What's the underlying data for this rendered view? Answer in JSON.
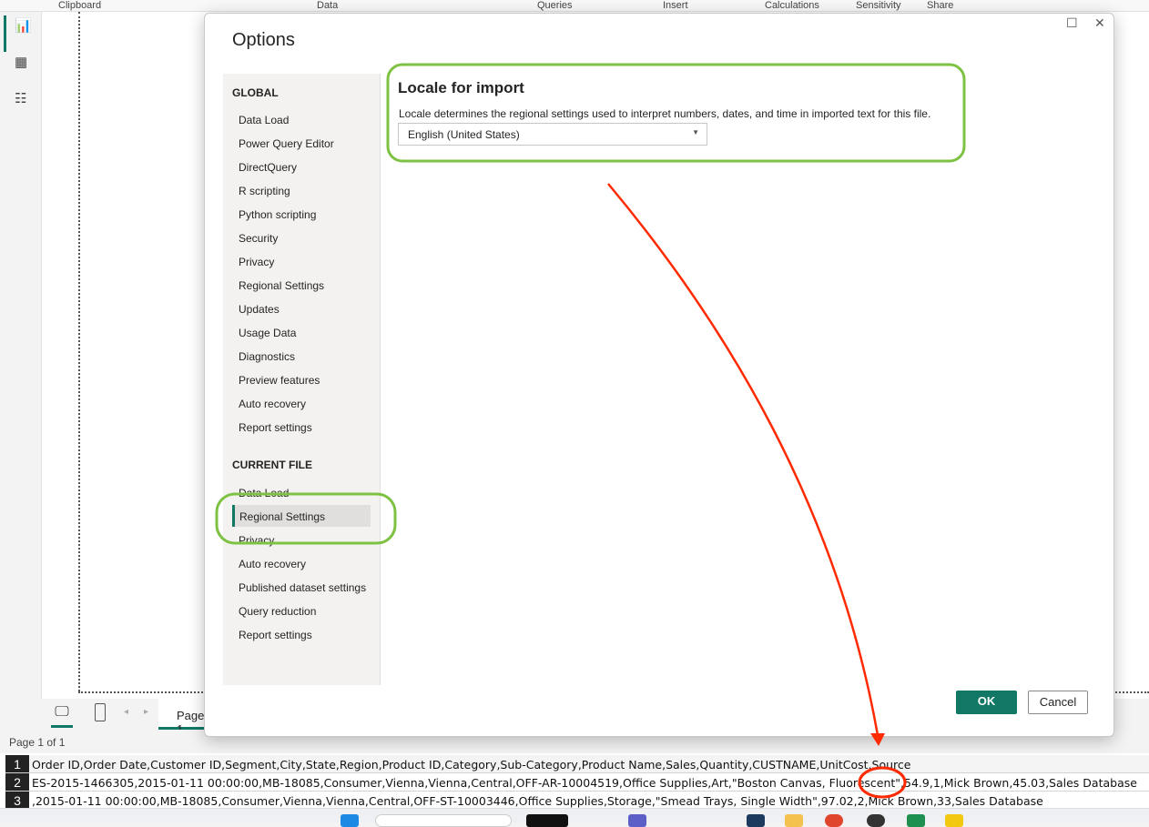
{
  "ribbon": {
    "groups": [
      "Clipboard",
      "Data",
      "Queries",
      "Insert",
      "Calculations",
      "Sensitivity",
      "Share"
    ]
  },
  "pagebar": {
    "tab": "Page 1"
  },
  "status": {
    "page": "Page 1 of 1"
  },
  "sheet": {
    "rows": [
      {
        "num": "1",
        "text": "Order ID,Order Date,Customer ID,Segment,City,State,Region,Product ID,Category,Sub-Category,Product Name,Sales,Quantity,CUSTNAME,UnitCost,Source"
      },
      {
        "num": "2",
        "text": "ES-2015-1466305,2015-01-11 00:00:00,MB-18085,Consumer,Vienna,Vienna,Central,OFF-AR-10004519,Office Supplies,Art,\"Boston Canvas, Fluorescent\",54.9,1,Mick Brown,45.03,Sales Database"
      },
      {
        "num": "3",
        "text": ",2015-01-11 00:00:00,MB-18085,Consumer,Vienna,Vienna,Central,OFF-ST-10003446,Office Supplies,Storage,\"Smead Trays, Single Width\",97.02,2,Mick Brown,33,Sales Database"
      }
    ]
  },
  "dialog": {
    "title": "Options",
    "global_header": "GLOBAL",
    "global_items": [
      "Data Load",
      "Power Query Editor",
      "DirectQuery",
      "R scripting",
      "Python scripting",
      "Security",
      "Privacy",
      "Regional Settings",
      "Updates",
      "Usage Data",
      "Diagnostics",
      "Preview features",
      "Auto recovery",
      "Report settings"
    ],
    "current_header": "CURRENT FILE",
    "current_items": [
      "Data Load",
      "Regional Settings",
      "Privacy",
      "Auto recovery",
      "Published dataset settings",
      "Query reduction",
      "Report settings"
    ],
    "section_title": "Locale for import",
    "section_desc": "Locale determines the regional settings used to interpret numbers, dates, and time in imported text for this file.",
    "locale_value": "English (United States)",
    "ok": "OK",
    "cancel": "Cancel"
  },
  "colors": {
    "accent": "#117865",
    "highlight_green": "#7dc242",
    "annotation_red": "#ff2a00"
  }
}
